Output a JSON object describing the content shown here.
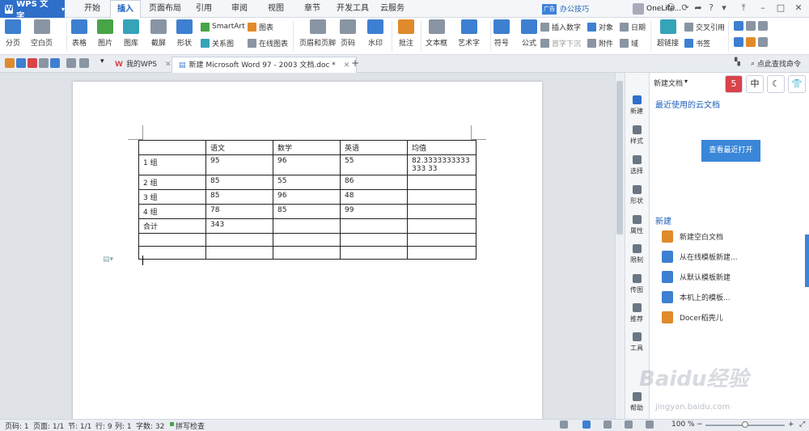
{
  "app": {
    "name": "WPS 文字",
    "logo_letter": "W"
  },
  "menu_tabs": [
    "开始",
    "插入",
    "页面布局",
    "引用",
    "审阅",
    "视图",
    "章节",
    "开发工具",
    "云服务"
  ],
  "active_menu": "插入",
  "titlebar": {
    "ad_badge": "广告",
    "tips": "办公技巧",
    "user": "OneLife..."
  },
  "ribbon": {
    "fenye": "分页",
    "kongbaiye": "空白页",
    "biaoge": "表格",
    "tupian": "图片",
    "tuku": "图库",
    "jieping": "截屏",
    "xingzhuang": "形状",
    "smartart": "SmartArt",
    "tubiao": "图表",
    "guanxitu": "关系图",
    "zaixiantubiao": "在线图表",
    "yemei": "页眉和页脚",
    "yema": "页码",
    "shuiyin": "水印",
    "pizhu": "批注",
    "wenbenkuang": "文本框",
    "yishuzi": "艺术字",
    "fuhao": "符号",
    "gongshi": "公式",
    "charushuzi": "插入数字",
    "duixiang": "对象",
    "riqi": "日期",
    "shouzixiachen": "首字下沉",
    "fujian": "附件",
    "yu": "域",
    "chaolianjie": "超链接",
    "jiaochayinyong": "交叉引用",
    "shuqian": "书签"
  },
  "doc_tabs": [
    {
      "label": "我的WPS"
    },
    {
      "label": "新建 Microsoft Word 97 - 2003 文档.doc *"
    }
  ],
  "cmd_search": "点此查找命令",
  "table": {
    "rows": [
      [
        "",
        "语文",
        "数学",
        "英语",
        "均值"
      ],
      [
        "1 组",
        "95",
        "96",
        "55",
        "82.3333333333333 33"
      ],
      [
        "2 组",
        "85",
        "55",
        "86",
        ""
      ],
      [
        "3 组",
        "85",
        "96",
        "48",
        ""
      ],
      [
        "4 组",
        "78",
        "85",
        "99",
        ""
      ],
      [
        "合计",
        "343",
        "",
        "",
        ""
      ],
      [
        "",
        "",
        "",
        "",
        ""
      ],
      [
        "",
        "",
        "",
        "",
        ""
      ]
    ]
  },
  "strip": [
    "新建",
    "样式",
    "选择",
    "形状",
    "属性",
    "限制",
    "传图",
    "推荐",
    "工具",
    "帮助"
  ],
  "panel": {
    "title": "新建文档",
    "tools": [
      "5",
      "中",
      "☾",
      "👕"
    ],
    "cloud_link": "最近使用的云文档",
    "open_button": "查看最近打开",
    "new_header": "新建",
    "new_items": [
      "新建空白文档",
      "从在线模板新建...",
      "从默认模板新建",
      "本机上的模板...",
      "Docer稻壳儿"
    ]
  },
  "status": {
    "page": "页码: 1",
    "pages": "页面: 1/1",
    "section": "节: 1/1",
    "row": "行: 9",
    "col": "列: 1",
    "words": "字数: 32",
    "spell": "拼写检查",
    "zoom": "100 %"
  },
  "watermark": {
    "text": "Baidu经验",
    "sub": "jingyan.baidu.com"
  }
}
